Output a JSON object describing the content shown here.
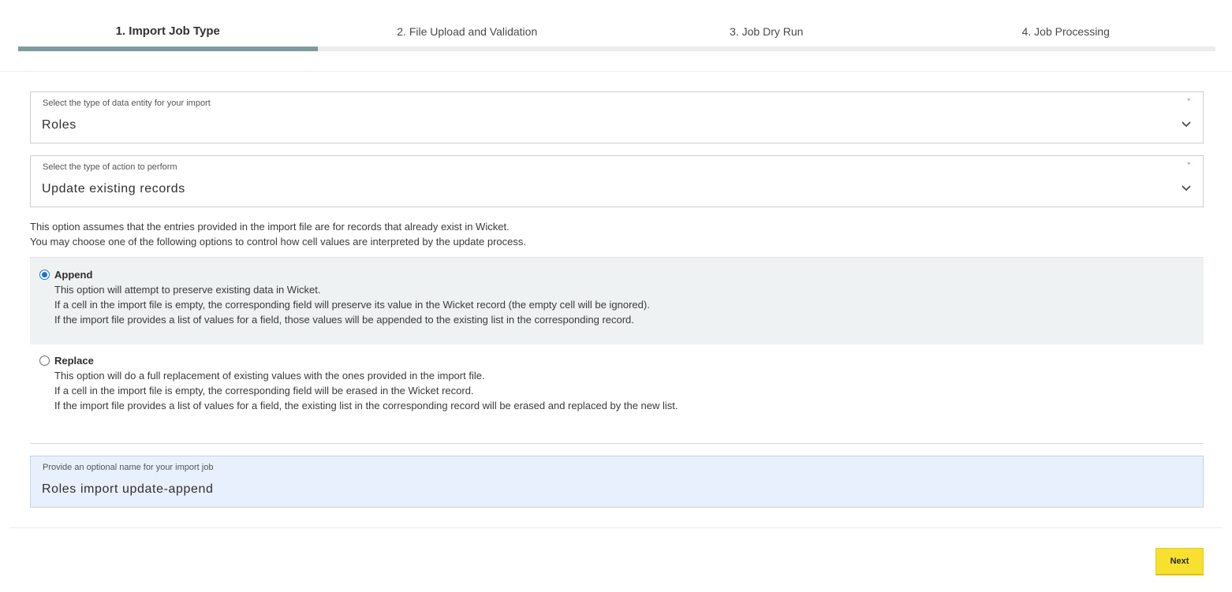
{
  "stepper": {
    "steps": [
      {
        "label": "1. Import Job Type",
        "active": true
      },
      {
        "label": "2. File Upload and Validation",
        "active": false
      },
      {
        "label": "3. Job Dry Run",
        "active": false
      },
      {
        "label": "4. Job Processing",
        "active": false
      }
    ]
  },
  "entity_select": {
    "label": "Select the type of data entity for your import",
    "value": "Roles",
    "required_mark": "*"
  },
  "action_select": {
    "label": "Select the type of action to perform",
    "value": "Update existing records",
    "required_mark": "*"
  },
  "description": {
    "line1": "This option assumes that the entries provided in the import file are for records that already exist in Wicket.",
    "line2": "You may choose one of the following options to control how cell values are interpreted by the update process."
  },
  "options": {
    "append": {
      "title": "Append",
      "selected": true,
      "lines": [
        "This option will attempt to preserve existing data in Wicket.",
        "If a cell in the import file is empty, the corresponding field will preserve its value in the Wicket record (the empty cell will be ignored).",
        "If the import file provides a list of values for a field, those values will be appended to the existing list in the corresponding record."
      ]
    },
    "replace": {
      "title": "Replace",
      "selected": false,
      "lines": [
        "This option will do a full replacement of existing values with the ones provided in the import file.",
        "If a cell in the import file is empty, the corresponding field will be erased in the Wicket record.",
        "If the import file provides a list of values for a field, the existing list in the corresponding record will be erased and replaced by the new list."
      ]
    }
  },
  "job_name": {
    "label": "Provide an optional name for your import job",
    "value": "Roles import update-append"
  },
  "footer": {
    "next_label": "Next"
  },
  "colors": {
    "active_step_bar": "#7f9aa1",
    "selected_option_bg": "#eff2f2",
    "name_field_bg": "#e8f0fd",
    "next_button": "#f7e02f"
  },
  "icons": {
    "select_arrow": "chevron-down-icon"
  }
}
